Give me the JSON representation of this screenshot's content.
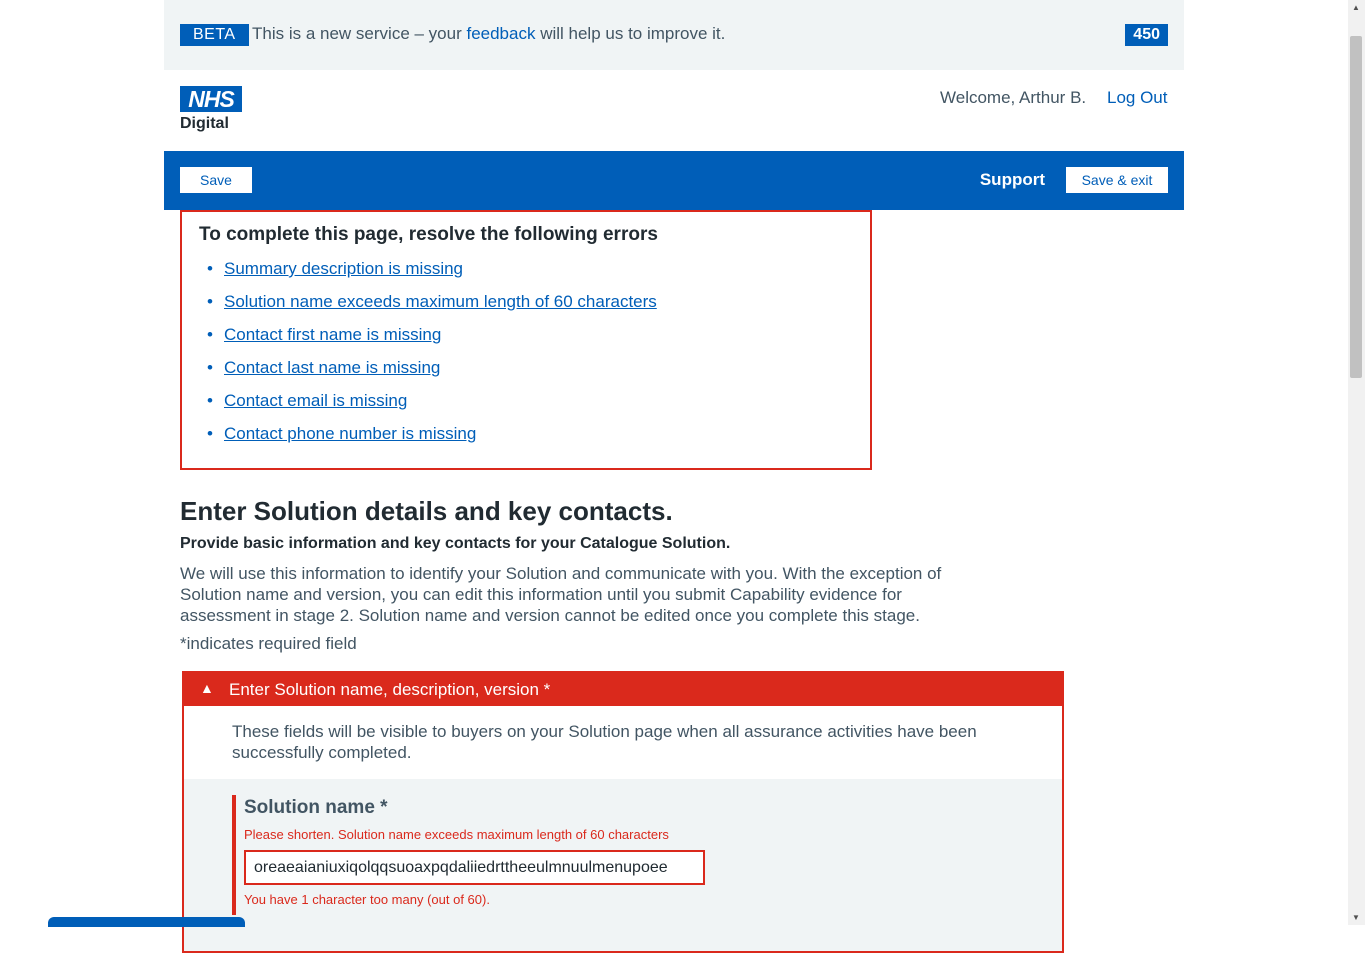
{
  "beta": {
    "tag": "BETA",
    "text_before": "This is a new service – your ",
    "link": "feedback",
    "text_after": " will help us to improve it.",
    "count": "450"
  },
  "header": {
    "logo_mark": "NHS",
    "logo_sub": "Digital",
    "welcome": "Welcome, Arthur B.",
    "logout": "Log Out"
  },
  "nav": {
    "save": "Save",
    "support": "Support",
    "save_exit": "Save & exit"
  },
  "errors": {
    "title": "To complete this page, resolve the following errors",
    "items": [
      "Summary description is missing",
      "Solution name exceeds maximum length of 60 characters",
      "Contact first name is missing",
      "Contact last name is missing",
      "Contact email is missing",
      "Contact phone number is missing"
    ]
  },
  "intro": {
    "title": "Enter Solution details and key contacts.",
    "lead": "Provide basic information and key contacts for your Catalogue Solution.",
    "body": "We will use this information to identify your Solution and communicate with you. With the exception of Solution name and version, you can edit this information until you submit Capability evidence for assessment in stage 2. Solution name and version cannot be edited once you complete this stage.",
    "required_note": "*indicates required field"
  },
  "section": {
    "toggle_icon": "▲",
    "title": "Enter Solution name, description, version *",
    "description": "These fields will be visible to buyers on your Solution page when all assurance activities have been successfully completed."
  },
  "solution_name": {
    "label": "Solution name *",
    "error": "Please shorten. Solution name exceeds maximum length of 60 characters",
    "value": "oreaeaianiuxiqolqqsuoaxpqdaliiedrttheeulmnuulmenupoee",
    "count_message": "You have 1 character too many (out of 60)."
  },
  "colors": {
    "nhs_blue": "#005eb8",
    "error_red": "#da291c",
    "pale_grey": "#f0f4f5"
  }
}
